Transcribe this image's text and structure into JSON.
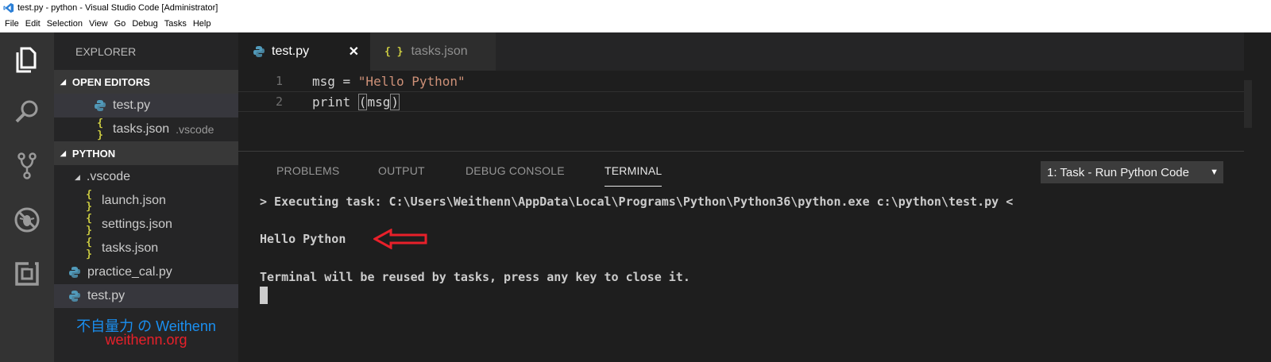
{
  "window": {
    "title": "test.py - python - Visual Studio Code [Administrator]"
  },
  "menu": [
    "File",
    "Edit",
    "Selection",
    "View",
    "Go",
    "Debug",
    "Tasks",
    "Help"
  ],
  "activity_bar": [
    {
      "icon": "files-icon"
    },
    {
      "icon": "search-icon"
    },
    {
      "icon": "source-control-icon"
    },
    {
      "icon": "debug-icon"
    },
    {
      "icon": "extensions-icon"
    }
  ],
  "explorer": {
    "title": "EXPLORER",
    "open_editors": {
      "label": "OPEN EDITORS",
      "items": [
        {
          "icon": "python-icon",
          "name": "test.py",
          "desc": ""
        },
        {
          "icon": "json-braces-icon",
          "name": "tasks.json",
          "desc": ".vscode"
        }
      ]
    },
    "folder": {
      "label": "PYTHON",
      "subfolder": ".vscode",
      "items": [
        {
          "icon": "json-braces-icon",
          "name": "launch.json"
        },
        {
          "icon": "json-braces-icon",
          "name": "settings.json"
        },
        {
          "icon": "json-braces-icon",
          "name": "tasks.json"
        },
        {
          "icon": "python-icon",
          "name": "practice_cal.py"
        },
        {
          "icon": "python-icon",
          "name": "test.py"
        }
      ]
    },
    "brace_glyph": "{ }"
  },
  "watermark": {
    "line1": "不自量力 の Weithenn",
    "line2": "weithenn.org",
    "color1": "#1a8ff0",
    "color2": "#e8202a"
  },
  "tabs": [
    {
      "label": "test.py",
      "active": true,
      "close": "✕"
    },
    {
      "label": "tasks.json",
      "active": false
    }
  ],
  "editor": {
    "lines": [
      {
        "num": "1",
        "pre": "msg = ",
        "str": "\"Hello Python\"",
        "post": ""
      },
      {
        "num": "2",
        "pre": "print ",
        "bracket_open": "(",
        "mid": "msg",
        "bracket_close": ")"
      }
    ]
  },
  "panel": {
    "tabs": [
      "PROBLEMS",
      "OUTPUT",
      "DEBUG CONSOLE",
      "TERMINAL"
    ],
    "active_tab": "TERMINAL",
    "task_select": "1: Task - Run Python Code",
    "terminal": {
      "line1": "> Executing task: C:\\Users\\Weithenn\\AppData\\Local\\Programs\\Python\\Python36\\python.exe c:\\python\\test.py <",
      "line2": "Hello Python",
      "line3": "Terminal will be reused by tasks, press any key to close it."
    }
  },
  "colors": {
    "accent_python": "#519aba",
    "json_braces": "#cbcb41",
    "annotation_arrow": "#e8202a"
  }
}
